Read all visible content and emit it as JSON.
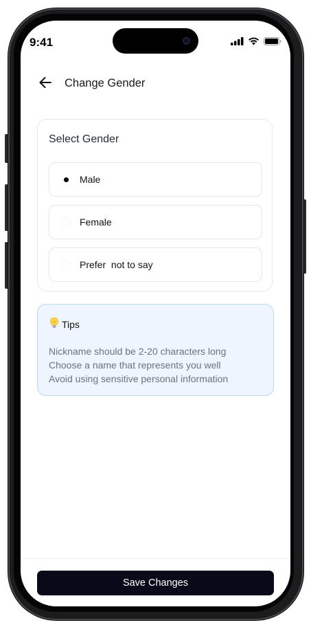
{
  "status_bar": {
    "time": "9:41"
  },
  "header": {
    "title": "Change Gender"
  },
  "gender_card": {
    "title": "Select Gender",
    "options": [
      {
        "label": "Male",
        "selected": true
      },
      {
        "label": "Female",
        "selected": false
      },
      {
        "label": "Prefer  not to say",
        "selected": false
      }
    ]
  },
  "tips": {
    "icon": "lightbulb-icon",
    "title": "Tips",
    "lines": [
      "Nickname should be 2-20 characters long",
      "Choose a name that represents you well",
      "Avoid using sensitive personal information"
    ]
  },
  "footer": {
    "save_label": "Save Changes"
  },
  "colors": {
    "primary_button": "#080a1a",
    "tips_background": "#eef5fe",
    "tips_border": "#b9d8f5",
    "card_border": "#e6e8ec"
  }
}
